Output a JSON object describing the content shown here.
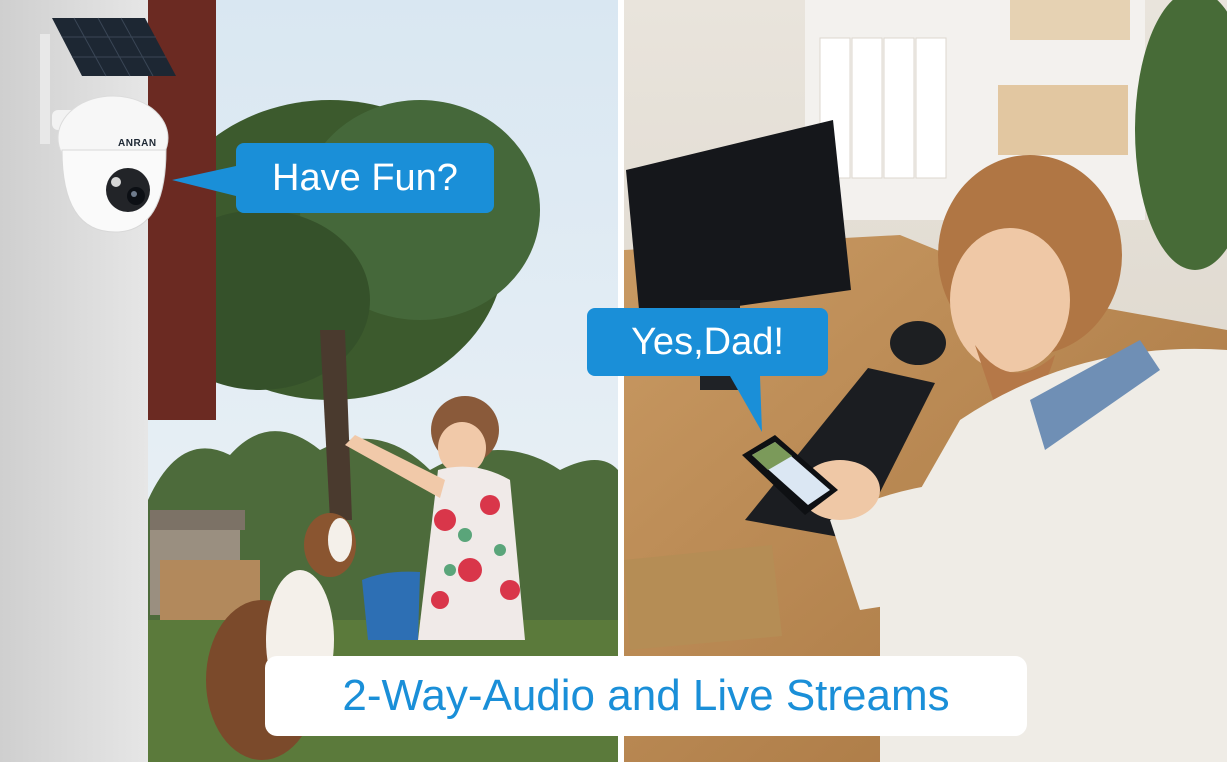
{
  "scene": {
    "left_panel": "girl-pointing-with-dog-outdoors",
    "right_panel": "man-at-desk-holding-phone"
  },
  "camera": {
    "brand": "ANRAN"
  },
  "bubbles": {
    "camera_speech": "Have Fun?",
    "child_reply": "Yes,Dad!"
  },
  "banner": {
    "headline": "2-Way-Audio and Live Streams"
  },
  "colors": {
    "accent_blue": "#1a8fd8",
    "banner_bg": "#ffffff",
    "bubble_text": "#ffffff"
  }
}
